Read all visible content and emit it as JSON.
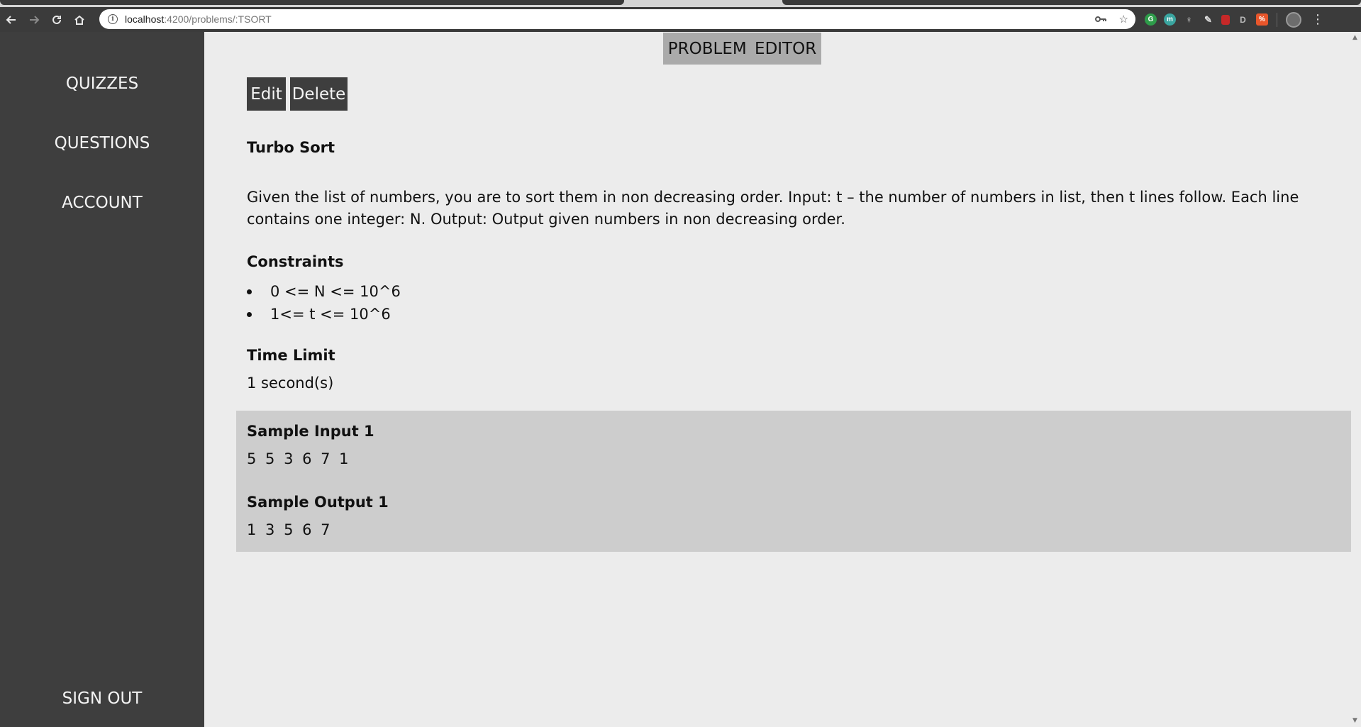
{
  "browser": {
    "url_host": "localhost",
    "url_path": ":4200/problems/:TSORT",
    "back_icon": "arrow-left",
    "forward_icon": "arrow-right",
    "reload_icon": "reload",
    "home_icon": "home"
  },
  "sidebar": {
    "items": [
      {
        "label": "QUIZZES"
      },
      {
        "label": "QUESTIONS"
      },
      {
        "label": "ACCOUNT"
      }
    ],
    "signout_label": "SIGN OUT"
  },
  "header": {
    "title": "PROBLEM EDITOR"
  },
  "actions": {
    "edit_label": "Edit",
    "delete_label": "Delete"
  },
  "problem": {
    "name": "Turbo Sort",
    "description": "Given the list of numbers, you are to sort them in non decreasing order. Input: t – the number of numbers in list, then t lines follow. Each line contains one integer: N. Output: Output given numbers in non decreasing order.",
    "constraints_heading": "Constraints",
    "constraints": [
      "0 <= N <= 10^6",
      "1<= t <= 10^6"
    ],
    "time_limit_heading": "Time Limit",
    "time_limit": "1 second(s)",
    "samples": [
      {
        "input_heading": "Sample Input 1",
        "input": "5 5 3 6 7 1",
        "output_heading": "Sample Output 1",
        "output": "1 3 5 6 7"
      }
    ]
  },
  "colors": {
    "sidebar_bg": "#3e3e3e",
    "main_bg": "#ececec",
    "sample_bg": "#cdcdcd",
    "title_bg": "#aaaaaa"
  }
}
